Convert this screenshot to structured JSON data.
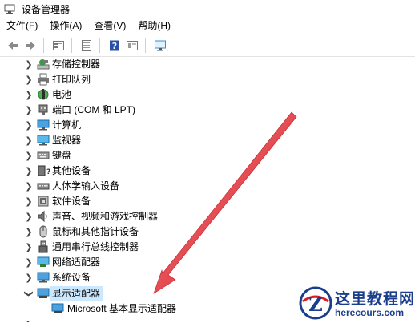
{
  "window": {
    "title": "设备管理器"
  },
  "menu": [
    "文件(F)",
    "操作(A)",
    "查看(V)",
    "帮助(H)"
  ],
  "toolbar": [
    "back-icon",
    "forward-icon",
    "properties-icon",
    "update-icon",
    "help-icon",
    "view-icon",
    "monitor-icon"
  ],
  "tree": {
    "items": [
      {
        "label": "存储控制器",
        "icon": "storage-controller-icon",
        "expanded": false
      },
      {
        "label": "打印队列",
        "icon": "print-queue-icon",
        "expanded": false
      },
      {
        "label": "电池",
        "icon": "battery-icon",
        "expanded": false
      },
      {
        "label": "端口 (COM 和 LPT)",
        "icon": "port-icon",
        "expanded": false
      },
      {
        "label": "计算机",
        "icon": "computer-icon",
        "expanded": false
      },
      {
        "label": "监视器",
        "icon": "monitor-icon",
        "expanded": false
      },
      {
        "label": "键盘",
        "icon": "keyboard-icon",
        "expanded": false
      },
      {
        "label": "其他设备",
        "icon": "other-devices-icon",
        "expanded": false
      },
      {
        "label": "人体学输入设备",
        "icon": "hid-icon",
        "expanded": false
      },
      {
        "label": "软件设备",
        "icon": "software-device-icon",
        "expanded": false
      },
      {
        "label": "声音、视频和游戏控制器",
        "icon": "sound-icon",
        "expanded": false
      },
      {
        "label": "鼠标和其他指针设备",
        "icon": "mouse-icon",
        "expanded": false
      },
      {
        "label": "通用串行总线控制器",
        "icon": "usb-icon",
        "expanded": false
      },
      {
        "label": "网络适配器",
        "icon": "network-adapter-icon",
        "expanded": false
      },
      {
        "label": "系统设备",
        "icon": "system-device-icon",
        "expanded": false
      },
      {
        "label": "显示适配器",
        "icon": "display-adapter-icon",
        "expanded": true,
        "selected": true
      }
    ],
    "child": {
      "label": "Microsoft 基本显示适配器",
      "icon": "display-adapter-icon"
    }
  },
  "watermark": {
    "cn": "这里教程网",
    "en": "herecours.com"
  },
  "colors": {
    "selection": "#cce8ff",
    "arrow": "#e0313a",
    "watermark": "#1a3e8c"
  }
}
